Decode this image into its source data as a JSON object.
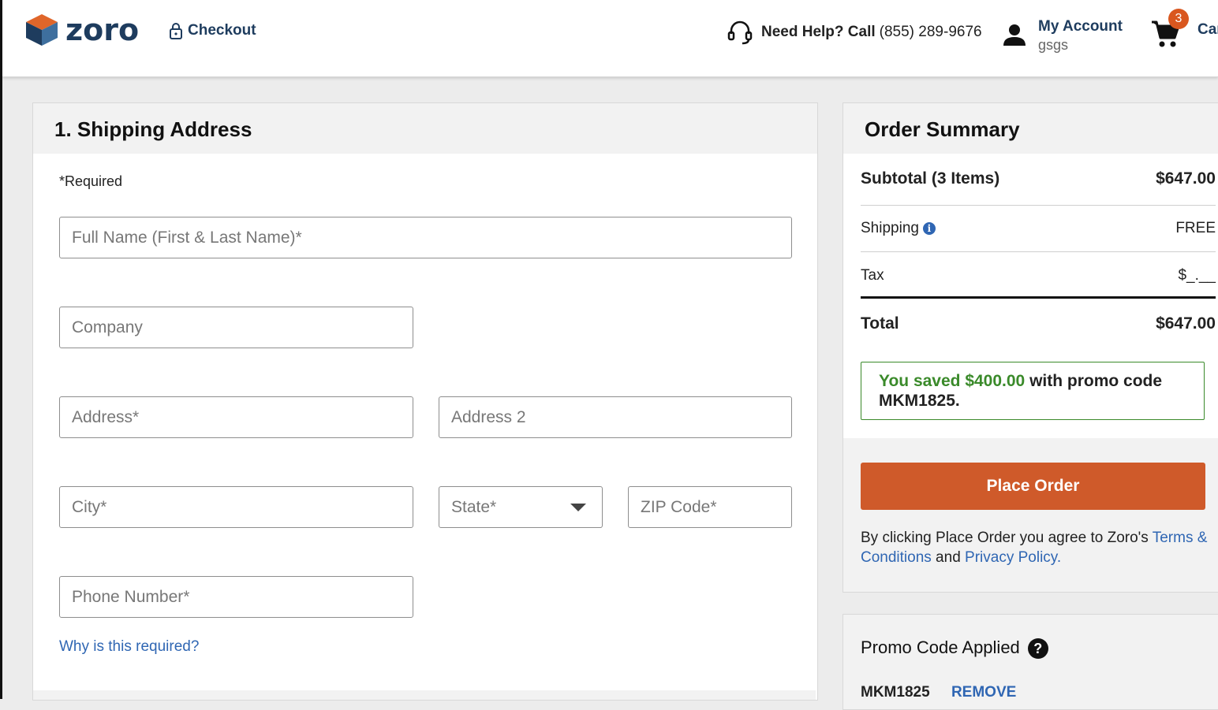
{
  "header": {
    "logo_text": "zoro",
    "checkout_label": "Checkout",
    "help_strong": "Need Help? Call",
    "help_phone": "(855) 289-9676",
    "account_label": "My Account",
    "account_user": "gsgs",
    "cart_count": "3",
    "cart_label": "Car"
  },
  "shipping": {
    "title": "1. Shipping Address",
    "required_note": "*Required",
    "fields": {
      "full_name": "Full Name (First & Last Name)*",
      "company": "Company",
      "address": "Address*",
      "address2": "Address 2",
      "city": "City*",
      "state": "State*",
      "zip": "ZIP Code*",
      "phone": "Phone Number*"
    },
    "why_link": "Why is this required?"
  },
  "summary": {
    "title": "Order Summary",
    "subtotal_label": "Subtotal (3 Items)",
    "subtotal_value": "$647.00",
    "shipping_label": "Shipping",
    "shipping_value": "FREE",
    "tax_label": "Tax",
    "tax_value": "$_.__",
    "total_label": "Total",
    "total_value": "$647.00",
    "promo_saved_prefix": "You saved $400.00",
    "promo_saved_suffix": " with promo code MKM1825.",
    "place_order": "Place Order",
    "agree_text": "By clicking Place Order you agree to Zoro's ",
    "terms_link": "Terms & Conditions",
    "agree_and": " and ",
    "privacy_link": "Privacy Policy."
  },
  "promo": {
    "title": "Promo Code Applied",
    "code": "MKM1825",
    "remove": "REMOVE"
  },
  "colors": {
    "brand": "#1e3c5e",
    "accent": "#cf5a2a",
    "link": "#2f66b3",
    "success": "#3a8a2a"
  }
}
